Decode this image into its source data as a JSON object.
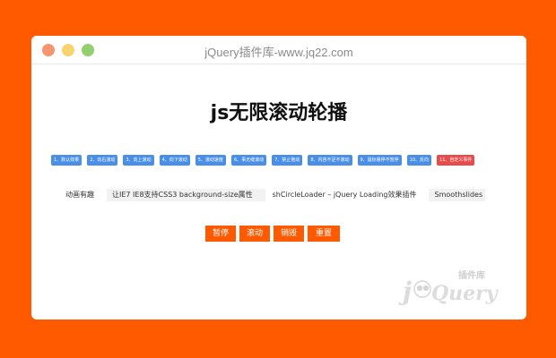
{
  "window": {
    "title": "jQuery插件库-www.jq22.com"
  },
  "page": {
    "title": "js无限滚动轮播"
  },
  "options": [
    {
      "label": "1、默认效果",
      "active": false
    },
    {
      "label": "2、向右滚动",
      "active": false
    },
    {
      "label": "3、向上滚动",
      "active": false
    },
    {
      "label": "4、向下滚动",
      "active": false
    },
    {
      "label": "5、滚动速度",
      "active": false
    },
    {
      "label": "6、事无缝滚动",
      "active": false
    },
    {
      "label": "7、禁止拖动",
      "active": false
    },
    {
      "label": "8、内容不足不滚动",
      "active": false
    },
    {
      "label": "9、鼠标悬停不暂停",
      "active": false
    },
    {
      "label": "10、反向",
      "active": false
    },
    {
      "label": "11、自定义事件",
      "active": true
    }
  ],
  "marquee": {
    "items": [
      "动画有趣",
      "让IE7 IE8支持CSS3 background-size属性",
      "shCircleLoader – jQuery Loading效果插件",
      "Smoothslides – 巴"
    ]
  },
  "actions": {
    "pause": "暂停",
    "scroll": "滚动",
    "destroy": "销毁",
    "reset": "重置"
  },
  "logo": {
    "brand": "jQuery",
    "tagline": "插件库"
  },
  "colors": {
    "background": "#ff5a00",
    "option_button": "#4a8fe7",
    "option_active": "#e84b4b",
    "action_button": "#ff5a00"
  }
}
